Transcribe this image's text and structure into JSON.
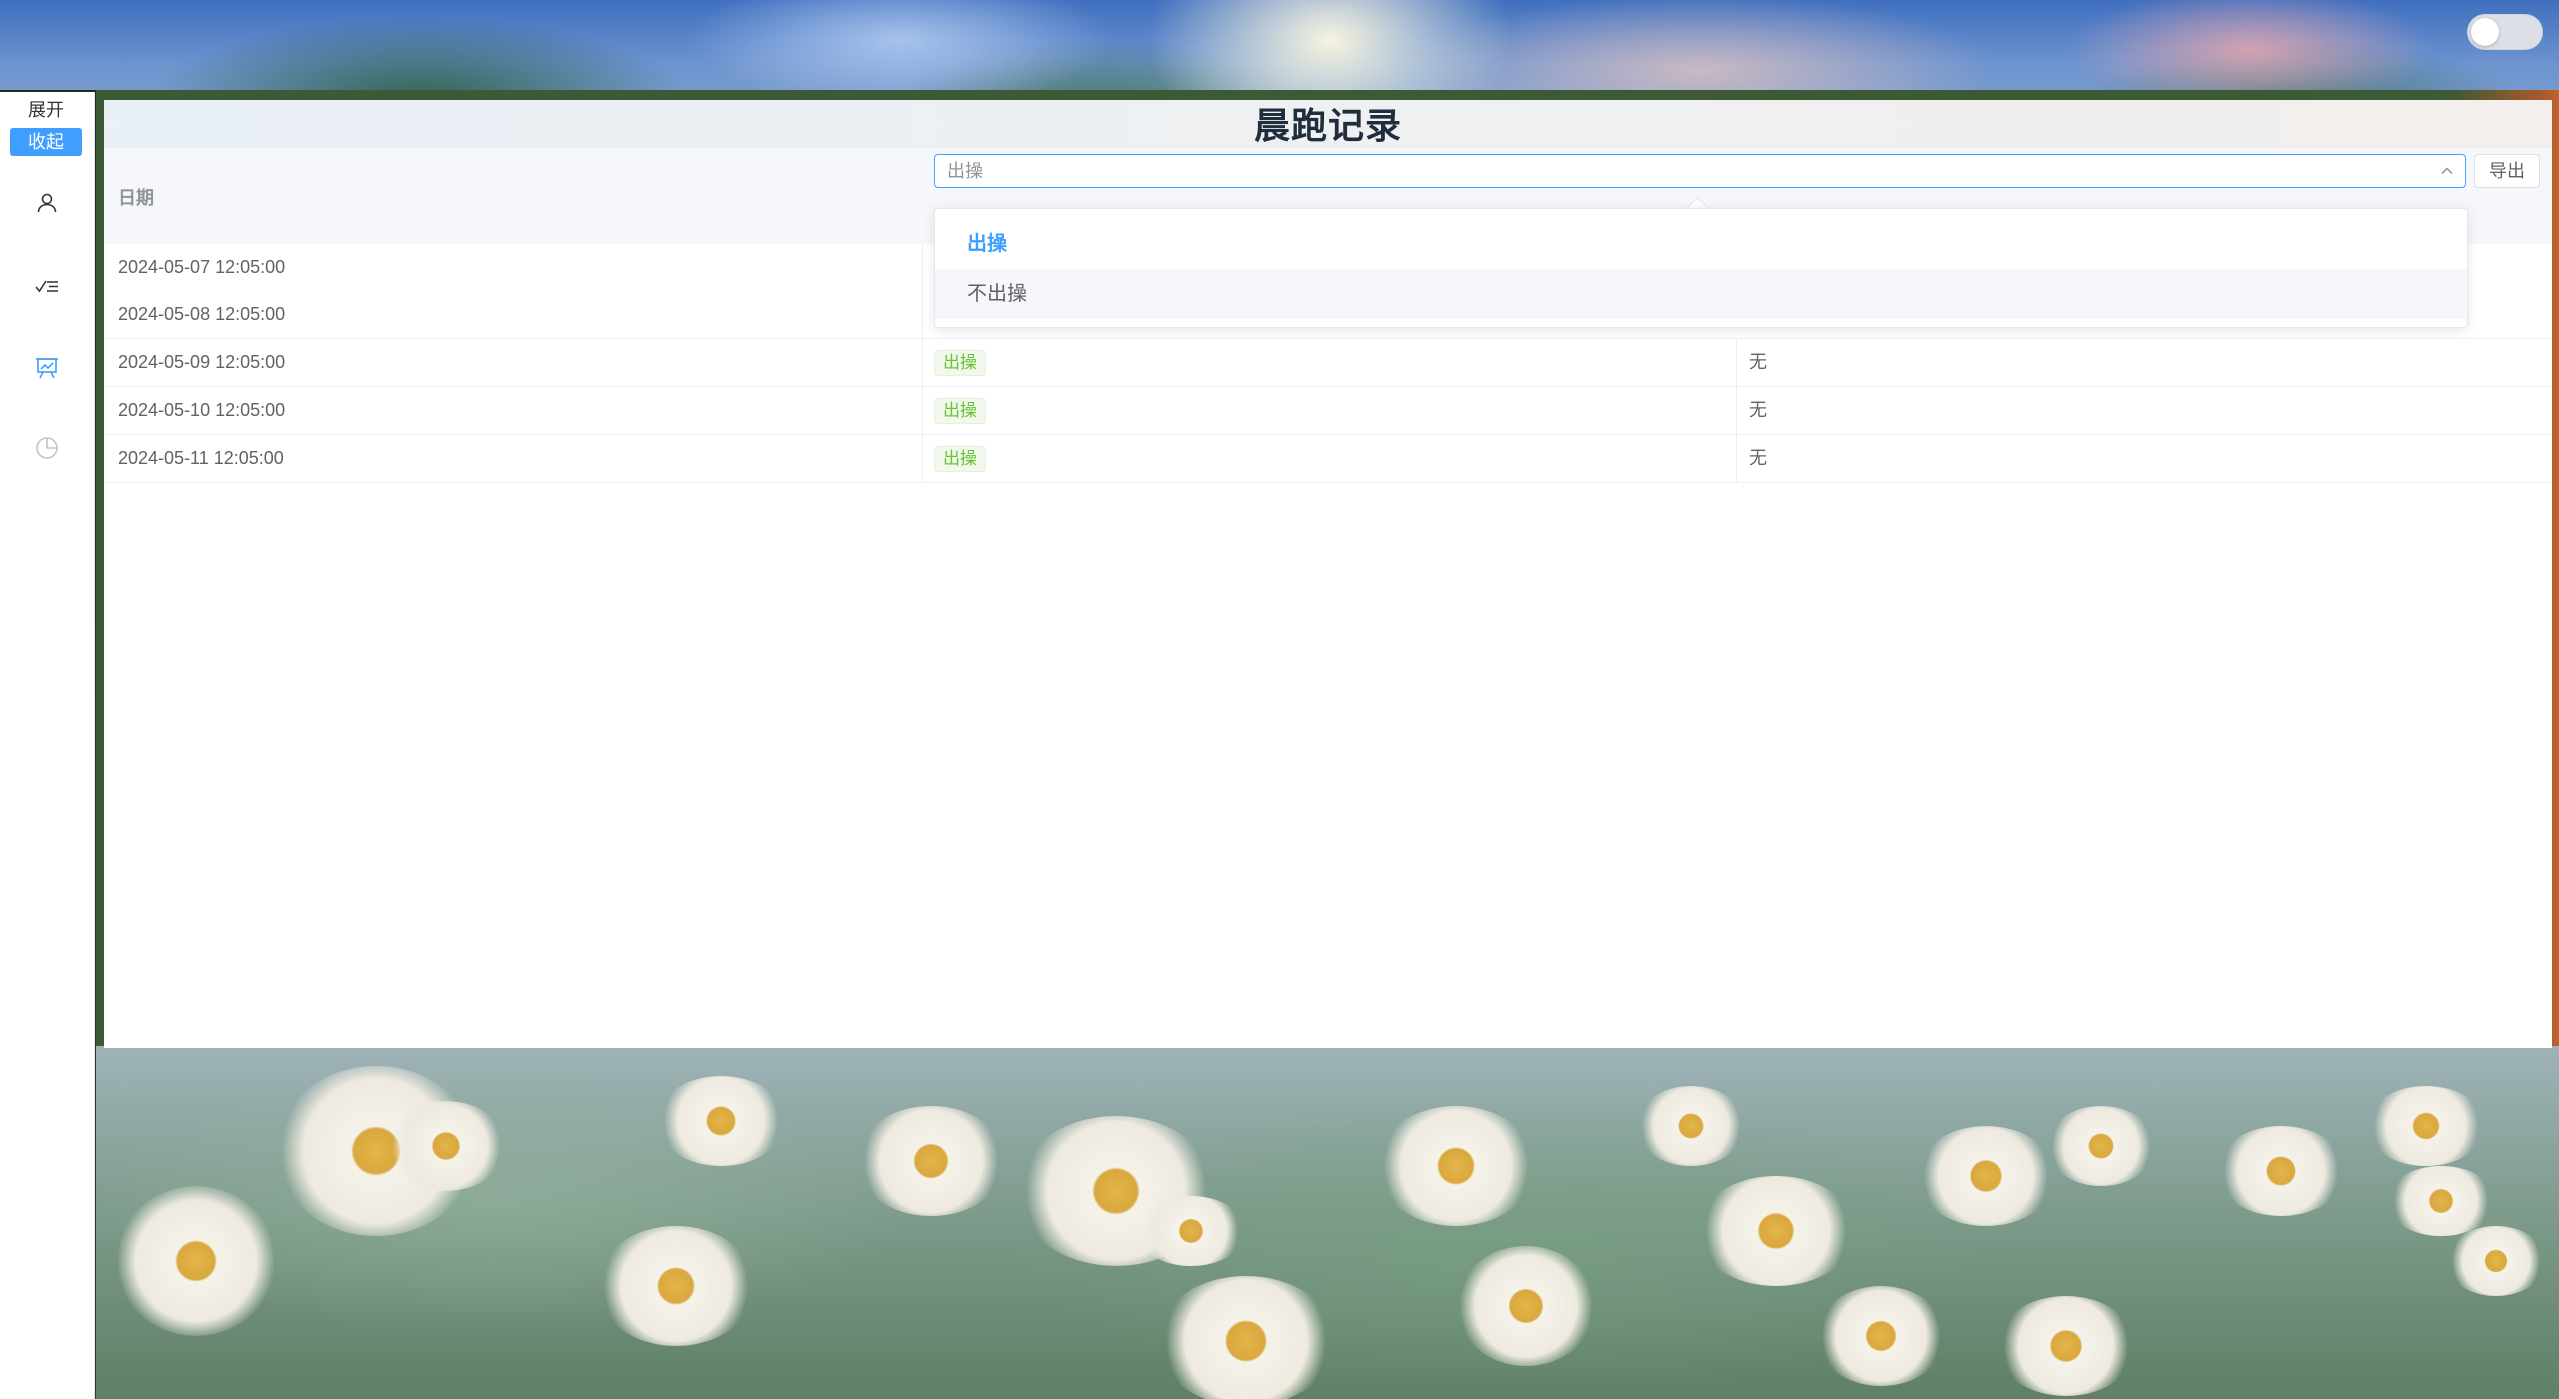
{
  "toggle": {
    "state": "off"
  },
  "sidebar": {
    "expand_label": "展开",
    "collapse_label": "收起",
    "items": [
      {
        "icon": "user-icon",
        "active": false
      },
      {
        "icon": "checklist-icon",
        "active": false
      },
      {
        "icon": "chart-board-icon",
        "active": true
      },
      {
        "icon": "pie-chart-icon",
        "active": false
      }
    ]
  },
  "page": {
    "title": "晨跑记录"
  },
  "table": {
    "headers": {
      "date": "日期"
    },
    "rows": [
      {
        "date": "2024-05-07 12:05:00",
        "status": "",
        "remark": ""
      },
      {
        "date": "2024-05-08 12:05:00",
        "status": "",
        "remark": ""
      },
      {
        "date": "2024-05-09 12:05:00",
        "status": "出操",
        "remark": "无"
      },
      {
        "date": "2024-05-10 12:05:00",
        "status": "出操",
        "remark": "无"
      },
      {
        "date": "2024-05-11 12:05:00",
        "status": "出操",
        "remark": "无"
      }
    ]
  },
  "filter": {
    "value": "出操",
    "options": [
      {
        "label": "出操",
        "selected": true
      },
      {
        "label": "不出操",
        "selected": false
      }
    ]
  },
  "export_label": "导出",
  "colors": {
    "accent": "#409eff",
    "success": "#67c23a"
  }
}
